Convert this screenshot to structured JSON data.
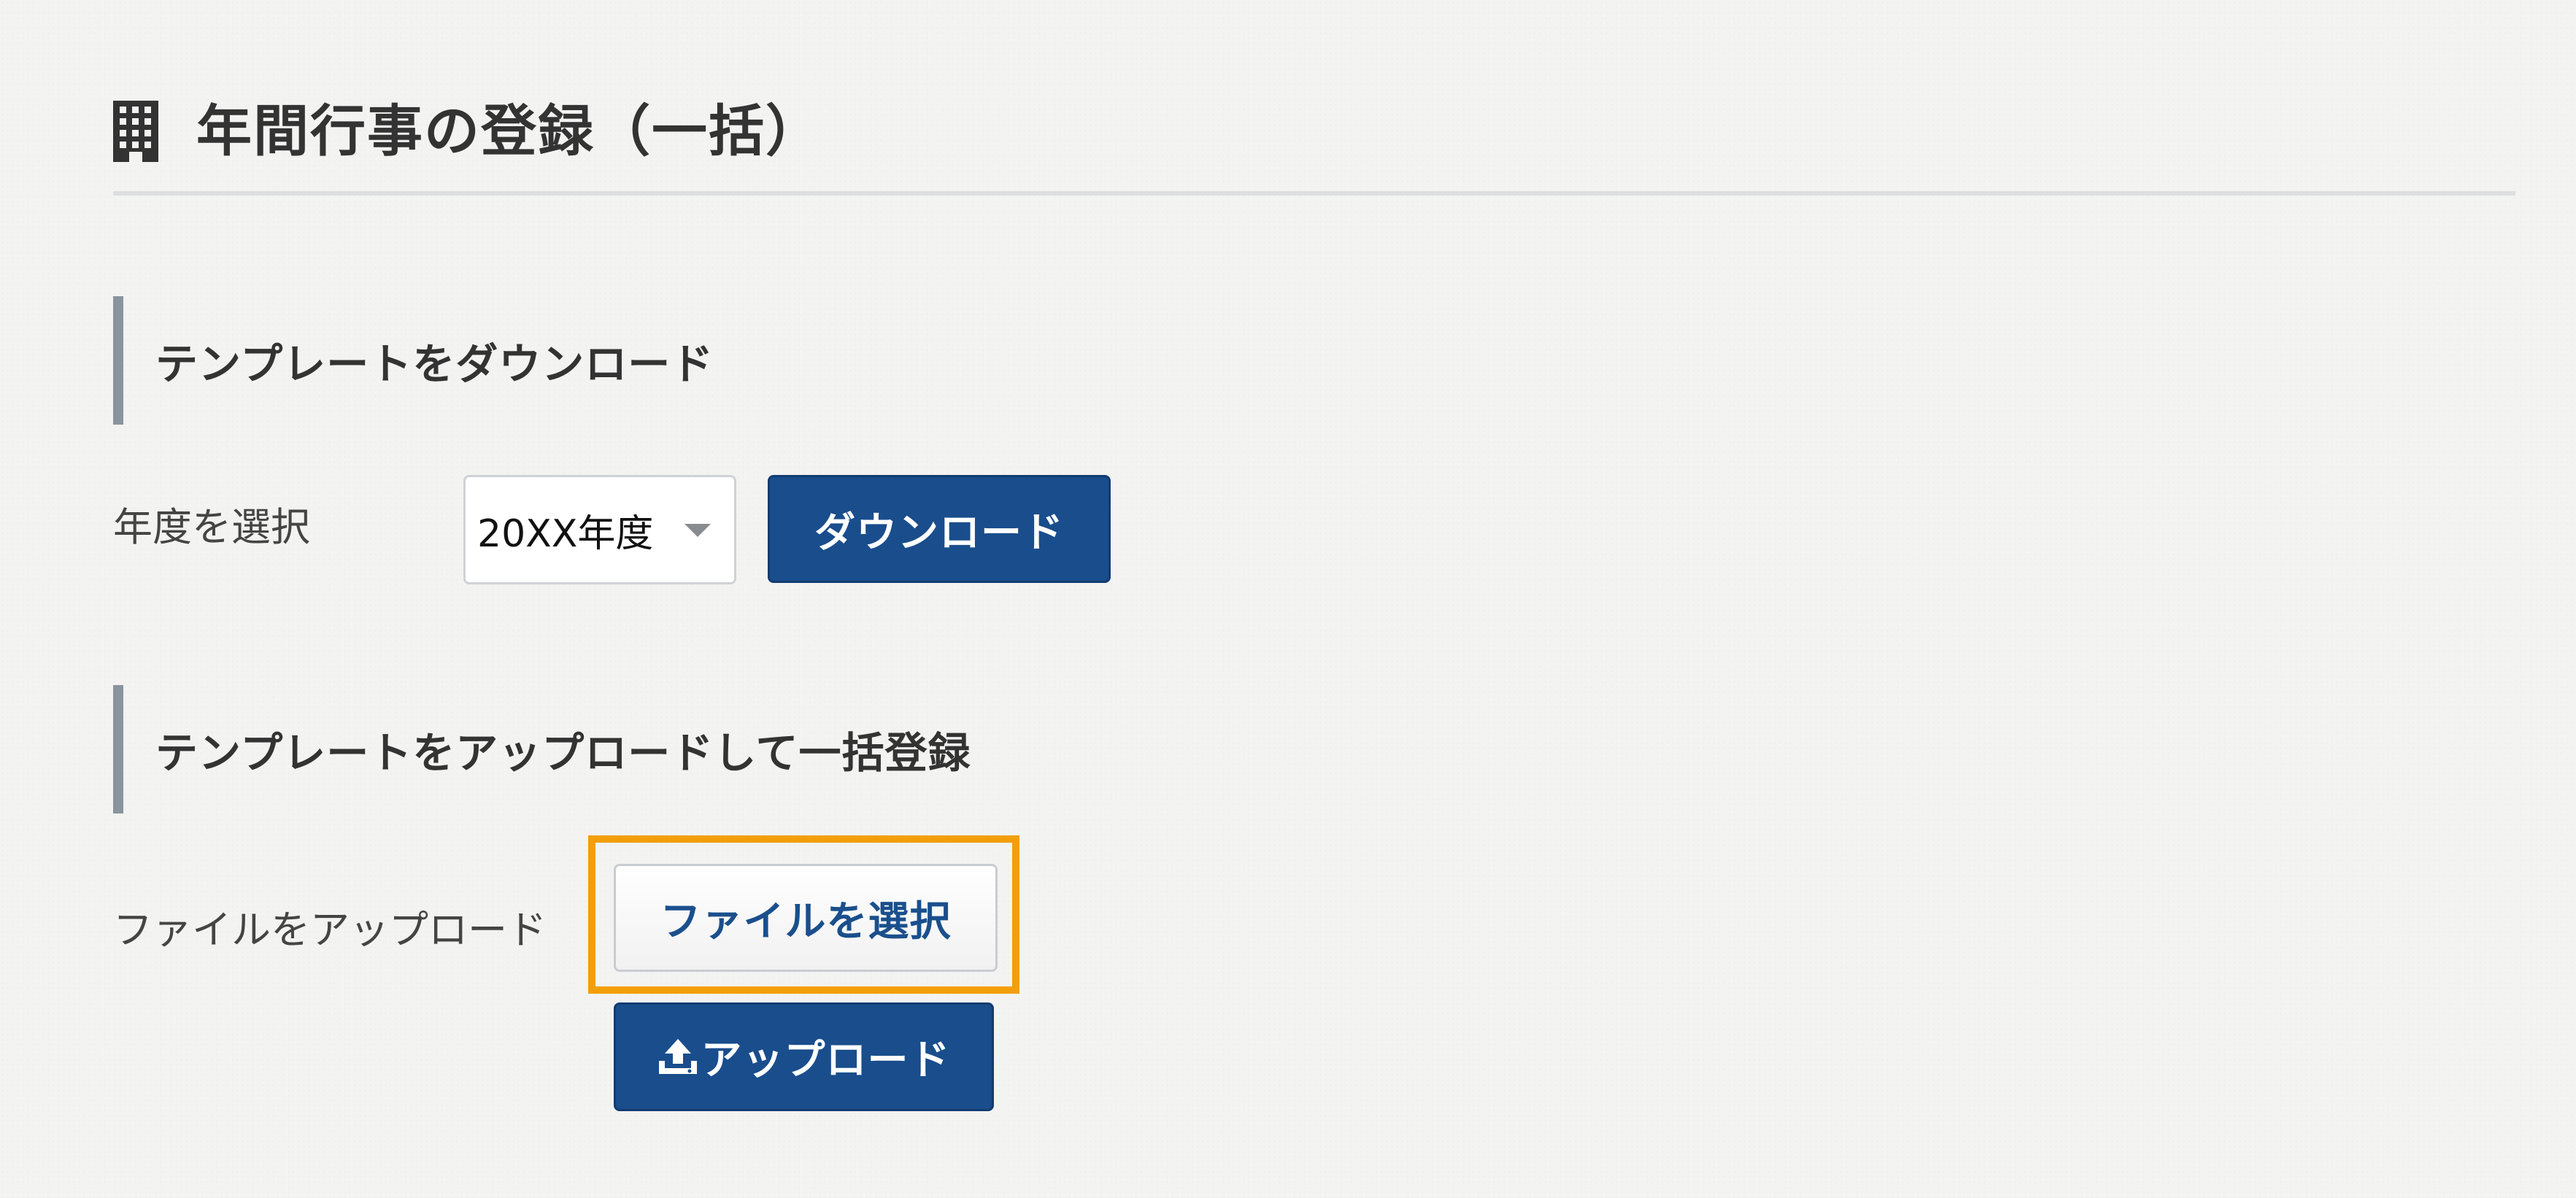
{
  "page": {
    "title": "年間行事の登録（一括）",
    "title_icon": "building-icon"
  },
  "download_section": {
    "heading": "テンプレートをダウンロード",
    "year_label": "年度を選択",
    "year_select": {
      "selected": "20XX年度",
      "icon": "caret-down-icon"
    },
    "download_button": "ダウンロード"
  },
  "upload_section": {
    "heading": "テンプレートをアップロードして一括登録",
    "file_label": "ファイルをアップロード",
    "file_select_button": "ファイルを選択",
    "upload_button": "アップロード",
    "upload_icon": "upload-icon"
  },
  "colors": {
    "primary": "#194d8c",
    "highlight": "#f29f0a",
    "heading_bar": "#8a949c",
    "background": "#f3f3f2"
  }
}
